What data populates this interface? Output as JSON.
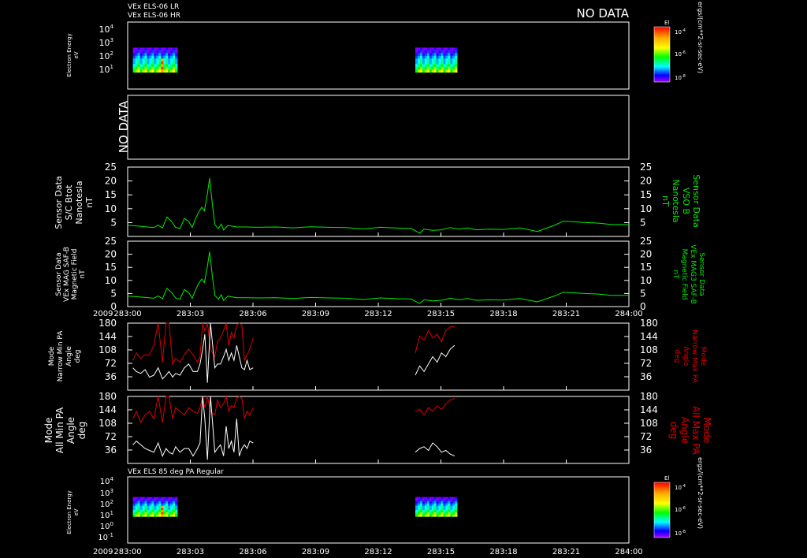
{
  "panels": {
    "p1": {
      "titles": [
        "VEx ELS-06 LR",
        "VEx ELS-06 HR"
      ],
      "status": "NO DATA",
      "ylabel": [
        "Electron Energy",
        "eV"
      ],
      "yticks": [
        {
          "b": "10",
          "e": "4"
        },
        {
          "b": "10",
          "e": "3"
        },
        {
          "b": "10",
          "e": "2"
        },
        {
          "b": "10",
          "e": "1"
        }
      ],
      "colorbar": {
        "title": "El",
        "ticks": [
          {
            "b": "10",
            "e": "-4"
          },
          {
            "b": "10",
            "e": "-6"
          },
          {
            "b": "10",
            "e": "-8"
          }
        ],
        "unit": "ergs/(cm**2-sr-sec-eV)"
      }
    },
    "p2": {
      "status": "NO DATA"
    },
    "p3": {
      "ylabel": [
        "Sensor Data",
        "S/C Btot",
        "Nanotesla",
        "nT"
      ],
      "ylabel_right": [
        "Sensor Data",
        "VSO B",
        "Nanotesla",
        "nT"
      ]
    },
    "p4": {
      "ylabel": [
        "Sensor Data",
        "VEx MAG SAF-B",
        "Magnetic Field",
        "nT"
      ],
      "ylabel_right": [
        "Sensor Data",
        "VEx MAG3 SAF-B",
        "Magnetic Field",
        "nT"
      ]
    },
    "p5": {
      "ylabel": [
        "Mode",
        "Narrow Min PA",
        "Angle",
        "deg"
      ],
      "ylabel_right": [
        "Mode",
        "Narrow Max PA",
        "Angle",
        "deg"
      ]
    },
    "p6": {
      "ylabel": [
        "Mode",
        "All Min PA",
        "Angle",
        "deg"
      ],
      "ylabel_right": [
        "Mode",
        "All Max PA",
        "Angle",
        "deg"
      ]
    },
    "p7": {
      "title": "VEx ELS 85 deg PA Regular",
      "ylabel": [
        "Electron Energy",
        "eV"
      ],
      "yticks": [
        {
          "b": "10",
          "e": "4"
        },
        {
          "b": "10",
          "e": "3"
        },
        {
          "b": "10",
          "e": "2"
        },
        {
          "b": "10",
          "e": "1"
        },
        {
          "b": "10",
          "e": "0"
        },
        {
          "b": "10",
          "e": "-1"
        }
      ],
      "colorbar": {
        "title": "El",
        "ticks": [
          {
            "b": "10",
            "e": "-4"
          },
          {
            "b": "10",
            "e": "-6"
          },
          {
            "b": "10",
            "e": "-8"
          }
        ],
        "unit": "ergs/(cm**2-sr-sec-eV)"
      }
    }
  },
  "x_axis": {
    "year": "2009",
    "labels": [
      "283:00",
      "283:03",
      "283:06",
      "283:09",
      "283:12",
      "283:15",
      "283:18",
      "283:21",
      "284:00"
    ]
  },
  "colors": {
    "field": "#00ee00",
    "max_pa": "#dd0000",
    "min_pa": "#ffffff",
    "nodata": "#ffffff"
  },
  "chart_data": [
    {
      "type": "heatmap",
      "panel": "p1",
      "ylabel": "Electron Energy eV",
      "y_scale": "log",
      "ylim": [
        1,
        10000
      ],
      "time_blocks_min": [
        [
          1.2,
          11.4
        ],
        [
          66.0,
          75.6
        ]
      ],
      "energy_range_eV": [
        10,
        300
      ]
    },
    {
      "type": "line",
      "panel": "p3",
      "ylim": [
        0,
        25
      ],
      "yticks": [
        5,
        10,
        15,
        20,
        25
      ],
      "xlim_min": [
        0,
        115
      ],
      "series": [
        {
          "color": "green",
          "x": [
            0,
            2,
            4,
            6,
            7,
            8,
            9,
            10,
            11,
            12,
            13,
            14,
            14.8,
            15.6,
            16.3,
            17,
            17.6,
            18.2,
            18.8,
            19.4,
            20,
            20.8,
            21.5,
            22,
            23,
            24,
            25,
            27,
            30,
            34,
            38,
            42,
            46,
            50,
            54,
            58,
            62,
            65,
            67,
            68,
            70,
            72,
            74,
            76,
            78,
            80,
            83,
            86,
            90,
            94,
            98,
            100,
            104,
            108,
            111,
            115
          ],
          "y": [
            4,
            3.8,
            3.5,
            3.2,
            4.1,
            3,
            7,
            5.5,
            3.3,
            2.8,
            6.5,
            5.4,
            3.2,
            6.5,
            8.8,
            10.5,
            9.2,
            14.5,
            21,
            12,
            4.3,
            2.8,
            4.5,
            2.3,
            4,
            3.7,
            3.4,
            3.4,
            3.3,
            3.4,
            3.1,
            3.5,
            3.3,
            3.2,
            2.7,
            3.3,
            3,
            2.9,
            1.2,
            2.6,
            2.2,
            2.4,
            3.2,
            2.6,
            3.1,
            2.4,
            2.6,
            2.5,
            3.1,
            1.8,
            4.1,
            5.5,
            5.1,
            4.8,
            4.3,
            4.3
          ]
        }
      ]
    },
    {
      "type": "line",
      "panel": "p4",
      "ylim": [
        0,
        25
      ],
      "yticks": [
        0,
        5,
        10,
        15,
        20,
        25
      ],
      "xlim_min": [
        0,
        115
      ],
      "series": [
        {
          "color": "green",
          "x": [
            0,
            2,
            4,
            6,
            7,
            8,
            9,
            10,
            11,
            12,
            13,
            14,
            14.8,
            15.6,
            16.3,
            17,
            17.6,
            18.2,
            18.8,
            19.4,
            20,
            20.8,
            21.5,
            22,
            23,
            24,
            25,
            27,
            30,
            34,
            38,
            42,
            46,
            50,
            54,
            58,
            62,
            65,
            67,
            68,
            70,
            72,
            74,
            76,
            78,
            80,
            83,
            86,
            90,
            94,
            98,
            100,
            104,
            108,
            111,
            115
          ],
          "y": [
            4,
            3.8,
            3.5,
            3.2,
            4.1,
            3,
            7,
            5.5,
            3.3,
            2.8,
            6.5,
            5.4,
            3.2,
            6.5,
            8.8,
            10.5,
            9.2,
            14.5,
            21,
            12,
            4.3,
            2.8,
            4.5,
            2.3,
            4,
            3.7,
            3.4,
            3.4,
            3.3,
            3.4,
            3.1,
            3.5,
            3.3,
            3.2,
            2.7,
            3.3,
            3,
            2.9,
            1.2,
            2.6,
            2.2,
            2.4,
            3.2,
            2.6,
            3.1,
            2.4,
            2.6,
            2.5,
            3.1,
            1.8,
            4.1,
            5.5,
            5.1,
            4.8,
            4.3,
            4.3
          ]
        }
      ]
    },
    {
      "type": "line",
      "panel": "p5",
      "ylim": [
        0,
        180
      ],
      "yticks": [
        36,
        72,
        108,
        144,
        180
      ],
      "series": [
        {
          "color": "red",
          "x": [
            1.2,
            2,
            3,
            4,
            5,
            6,
            7,
            8,
            8.8,
            9.5,
            10.3,
            11,
            12,
            13,
            14,
            15,
            16,
            16.6,
            17.2,
            17.7,
            18.3,
            19,
            20,
            20.6,
            21.3,
            22,
            22.6,
            23.2,
            23.8,
            24.4,
            25,
            25.6,
            26.2,
            26.8,
            27.4,
            28,
            28.8
          ],
          "y": [
            80,
            100,
            85,
            95,
            95,
            120,
            180,
            75,
            180,
            180,
            70,
            85,
            75,
            95,
            110,
            95,
            75,
            90,
            180,
            160,
            180,
            110,
            90,
            130,
            140,
            160,
            180,
            120,
            155,
            140,
            175,
            180,
            175,
            80,
            95,
            110,
            140
          ]
        },
        {
          "color": "red",
          "x": [
            66,
            67,
            68,
            69,
            70,
            71,
            72,
            73,
            74,
            75
          ],
          "y": [
            100,
            145,
            135,
            160,
            140,
            150,
            130,
            160,
            170,
            170
          ]
        }
      ]
    },
    {
      "type": "line",
      "panel": "p5",
      "series": [
        {
          "color": "white",
          "x": [
            1.2,
            2,
            3,
            4,
            5,
            6,
            7,
            8,
            8.8,
            9.5,
            10.3,
            11,
            12,
            13,
            14,
            15,
            16,
            16.6,
            17.2,
            17.7,
            18.3,
            19,
            20,
            20.6,
            21.3,
            22,
            22.6,
            23.2,
            23.8,
            24.4,
            25,
            25.6,
            26.2,
            26.8,
            27.4,
            28,
            28.8
          ],
          "y": [
            60,
            50,
            45,
            55,
            35,
            40,
            60,
            30,
            40,
            50,
            35,
            45,
            40,
            60,
            70,
            50,
            50,
            70,
            110,
            150,
            20,
            180,
            60,
            70,
            70,
            90,
            110,
            80,
            100,
            80,
            120,
            90,
            60,
            55,
            80,
            55,
            60
          ]
        },
        {
          "color": "white",
          "x": [
            66,
            67,
            68,
            69,
            70,
            71,
            72,
            73,
            74,
            75
          ],
          "y": [
            40,
            65,
            50,
            70,
            90,
            75,
            100,
            90,
            110,
            120
          ]
        }
      ]
    },
    {
      "type": "line",
      "panel": "p6",
      "ylim": [
        0,
        180
      ],
      "yticks": [
        36,
        72,
        108,
        144,
        180
      ],
      "series": [
        {
          "color": "red",
          "x": [
            1.2,
            2,
            3,
            4,
            5,
            6,
            7,
            8,
            8.8,
            9.5,
            10.3,
            11,
            12,
            13,
            14,
            15,
            16,
            16.6,
            17.2,
            17.7,
            18.3,
            19,
            20,
            20.6,
            21.3,
            22,
            22.6,
            23.2,
            23.8,
            24.4,
            25,
            25.6,
            26.2,
            26.8,
            27.4,
            28,
            28.8
          ],
          "y": [
            120,
            140,
            110,
            130,
            140,
            120,
            180,
            110,
            180,
            180,
            120,
            150,
            140,
            130,
            150,
            140,
            135,
            150,
            180,
            150,
            180,
            140,
            130,
            170,
            150,
            160,
            180,
            140,
            155,
            150,
            175,
            180,
            175,
            120,
            140,
            130,
            150
          ]
        },
        {
          "color": "red",
          "x": [
            66,
            67,
            68,
            69,
            70,
            71,
            72,
            73,
            74,
            75
          ],
          "y": [
            140,
            145,
            130,
            150,
            140,
            155,
            145,
            160,
            170,
            175
          ]
        }
      ]
    },
    {
      "type": "line",
      "panel": "p6",
      "series": [
        {
          "color": "white",
          "x": [
            1.2,
            2,
            3,
            4,
            5,
            6,
            7,
            8,
            8.8,
            9.5,
            10.3,
            11,
            12,
            13,
            14,
            15,
            16,
            16.6,
            17.2,
            17.7,
            18.3,
            19,
            20,
            20.6,
            21.3,
            22,
            22.6,
            23.2,
            23.8,
            24.4,
            25,
            25.6,
            26.2,
            26.8,
            27.4,
            28,
            28.8
          ],
          "y": [
            50,
            60,
            50,
            40,
            35,
            30,
            55,
            20,
            40,
            30,
            25,
            45,
            30,
            40,
            40,
            20,
            40,
            55,
            180,
            120,
            10,
            180,
            30,
            40,
            50,
            20,
            100,
            40,
            60,
            30,
            120,
            20,
            40,
            50,
            40,
            60,
            55
          ]
        },
        {
          "color": "white",
          "x": [
            66,
            67,
            68,
            69,
            70,
            71,
            72,
            73,
            74,
            75
          ],
          "y": [
            30,
            40,
            45,
            35,
            55,
            45,
            30,
            35,
            25,
            20
          ]
        }
      ]
    },
    {
      "type": "heatmap",
      "panel": "p7",
      "ylabel": "Electron Energy eV",
      "y_scale": "log",
      "ylim": [
        0.1,
        10000
      ],
      "time_blocks_min": [
        [
          1.2,
          11.4
        ],
        [
          66.0,
          75.6
        ]
      ],
      "energy_range_eV": [
        10,
        300
      ]
    }
  ]
}
